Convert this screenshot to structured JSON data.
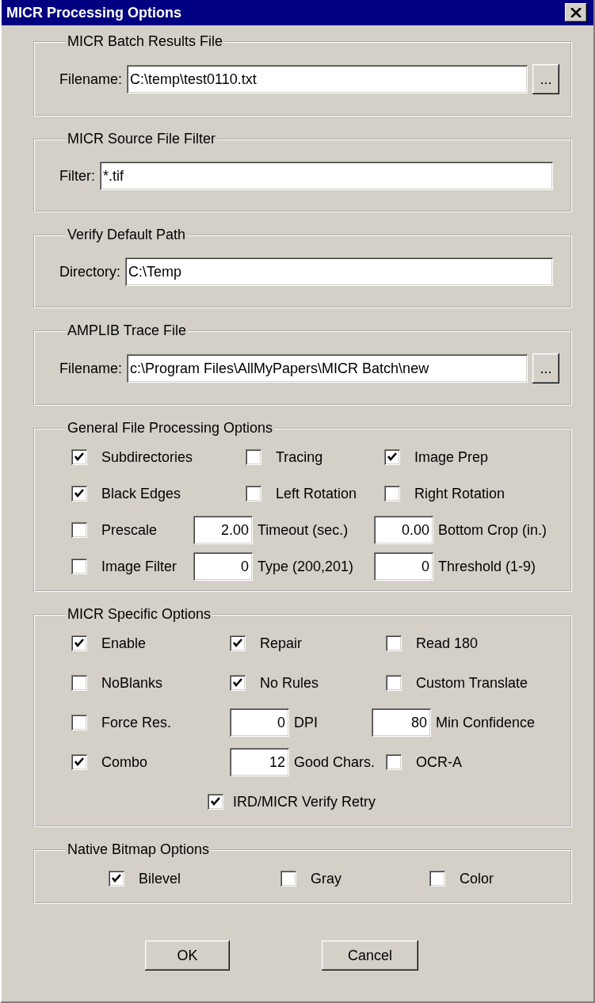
{
  "window": {
    "title": "MICR Processing Options"
  },
  "groups": [
    {
      "kind": "file",
      "title": "MICR Batch Results File",
      "label": "Filename:",
      "value": "C:\\temp\\test0110.txt",
      "browse": "..."
    },
    {
      "kind": "file",
      "title": "MICR Source File Filter",
      "label": "Filter:",
      "value": "*.tif"
    },
    {
      "kind": "file",
      "title": "Verify Default Path",
      "label": "Directory:",
      "value": "C:\\Temp"
    },
    {
      "kind": "file",
      "title": "AMPLIB Trace File",
      "label": "Filename:",
      "value": "c:\\Program Files\\AllMyPapers\\MICR Batch\\new",
      "browse": "..."
    },
    {
      "kind": "general",
      "title": "General File Processing Options",
      "rows": [
        [
          {
            "kind": "checkbox",
            "label": "Subdirectories",
            "checked": true
          },
          {
            "kind": "checkbox",
            "label": "Tracing",
            "checked": false
          },
          {
            "kind": "checkbox",
            "label": "Image Prep",
            "checked": true
          }
        ],
        [
          {
            "kind": "checkbox",
            "label": "Black Edges",
            "checked": true
          },
          {
            "kind": "checkbox",
            "label": "Left Rotation",
            "checked": false
          },
          {
            "kind": "checkbox",
            "label": "Right Rotation",
            "checked": false
          }
        ],
        [
          {
            "kind": "checkbox",
            "label": "Prescale",
            "checked": false
          },
          {
            "kind": "number",
            "value": "2.00",
            "label": "Timeout (sec.)"
          },
          {
            "kind": "number",
            "value": "0.00",
            "label": "Bottom Crop (in.)"
          }
        ],
        [
          {
            "kind": "checkbox",
            "label": "Image Filter",
            "checked": false
          },
          {
            "kind": "number",
            "value": "0",
            "label": "Type (200,201)"
          },
          {
            "kind": "number",
            "value": "0",
            "label": "Threshold (1-9)"
          }
        ]
      ]
    },
    {
      "kind": "micr",
      "title": "MICR Specific Options",
      "rows": [
        [
          {
            "kind": "checkbox",
            "label": "Enable",
            "checked": true
          },
          {
            "kind": "checkbox",
            "label": "Repair",
            "checked": true
          },
          {
            "kind": "checkbox",
            "label": "Read 180",
            "checked": false
          }
        ],
        [
          {
            "kind": "checkbox",
            "label": "NoBlanks",
            "checked": false
          },
          {
            "kind": "checkbox",
            "label": "No Rules",
            "checked": true
          },
          {
            "kind": "checkbox",
            "label": "Custom Translate",
            "checked": false
          }
        ],
        [
          {
            "kind": "checkbox",
            "label": "Force Res.",
            "checked": false
          },
          {
            "kind": "number",
            "value": "0",
            "label": "DPI"
          },
          {
            "kind": "number",
            "value": "80",
            "label": "Min Confidence"
          }
        ],
        [
          {
            "kind": "checkbox",
            "label": "Combo",
            "checked": true
          },
          {
            "kind": "number",
            "value": "12",
            "label": "Good Chars."
          },
          {
            "kind": "checkbox",
            "label": "OCR-A",
            "checked": false
          }
        ]
      ],
      "extra": {
        "kind": "checkbox",
        "label": "IRD/MICR Verify Retry",
        "checked": true
      }
    },
    {
      "kind": "bitmap",
      "title": "Native Bitmap Options",
      "rows": [
        [
          {
            "kind": "checkbox",
            "label": "Bilevel",
            "checked": true
          },
          {
            "kind": "checkbox",
            "label": "Gray",
            "checked": false
          },
          {
            "kind": "checkbox",
            "label": "Color",
            "checked": false
          }
        ]
      ]
    }
  ],
  "buttons": [
    {
      "label": "OK"
    },
    {
      "label": "Cancel"
    }
  ]
}
